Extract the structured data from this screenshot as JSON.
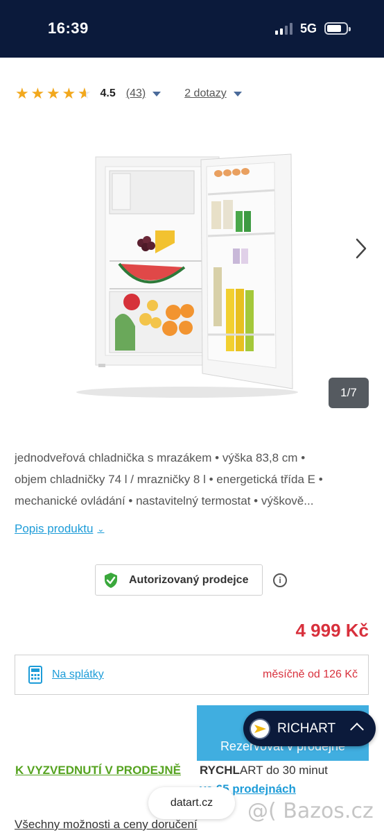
{
  "status_bar": {
    "time": "16:39",
    "network": "5G"
  },
  "rating": {
    "value": "4.5",
    "count": "(43)",
    "questions": "2 dotazy",
    "stars_filled": 4.5,
    "stars_total": 5
  },
  "gallery": {
    "counter": "1/7"
  },
  "description": {
    "lines": [
      "jednodveřová chladnička s mrazákem • výška 83,8 cm •",
      "objem chladničky 74 l / mrazničky 8 l • energetická třída E •",
      "mechanické ovládání • nastavitelný termostat • výškově..."
    ],
    "more_link": "Popis produktu"
  },
  "authorized": {
    "label": "Autorizovaný prodejce"
  },
  "price": "4 999 Kč",
  "installments": {
    "link": "Na splátky",
    "monthly": "měsíčně od 126 Kč"
  },
  "reserve_button": "Rezervovat v prodejně",
  "chat": {
    "name": "RICHART"
  },
  "pickup": {
    "label": "K VYZVEDNUTÍ V PRODEJNĚ",
    "fast_prefix": "RYCHL",
    "fast_suffix": "ART do 30 minut",
    "stores": "ve 65 prodejnách"
  },
  "browser": {
    "url": "datart.cz"
  },
  "delivery_link": "Všechny možnosti a ceny doručení",
  "watermark": "@( Bazos.cz",
  "colors": {
    "accent_blue": "#1d9cd8",
    "price_red": "#d8303c",
    "pickup_green": "#55a31f",
    "navy": "#0b1a3b",
    "star": "#f2a81d"
  }
}
